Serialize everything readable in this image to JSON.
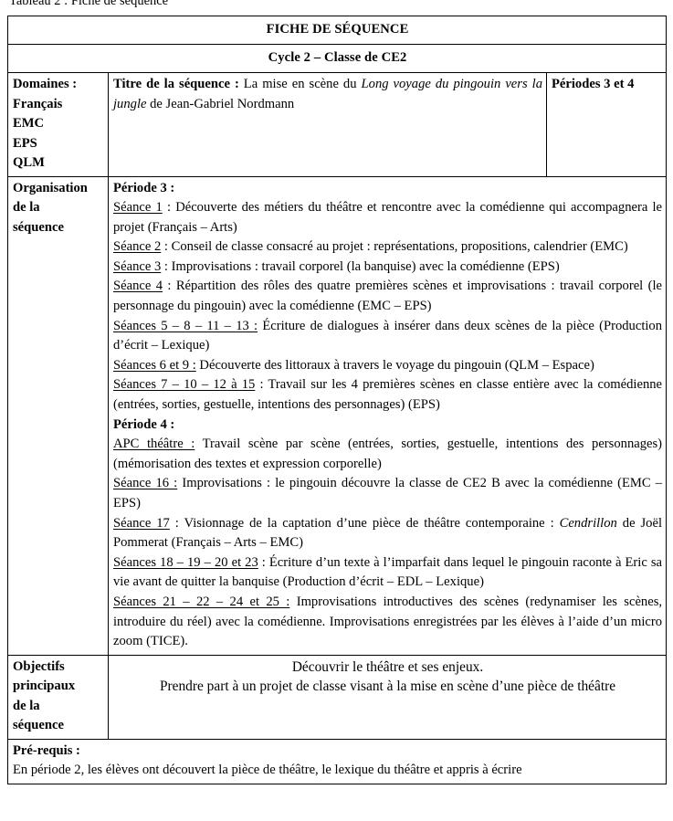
{
  "document": {
    "caption": "Tableau 2 : Fiche de séquence",
    "banner_title": "FICHE DE SÉQUENCE",
    "banner_subtitle": "Cycle 2 – Classe de CE2"
  },
  "row_domaines": {
    "label": "Domaines :\nFrançais\nEMC\nEPS\nQLM",
    "label_lines": [
      "Domaines :",
      "Français",
      "EMC",
      "EPS",
      "QLM"
    ],
    "title_prefix": "Titre de la séquence :",
    "title_text_1": " La mise en scène du ",
    "title_work": "Long voyage du pingouin vers la jungle",
    "title_text_2": " de Jean-Gabriel Nordmann",
    "periods": "Périodes 3 et 4"
  },
  "row_organisation": {
    "label_lines": [
      "Organisation",
      "de la",
      "séquence"
    ],
    "periode3_head": "Période 3 :",
    "periode4_head": "Période 4 :",
    "entries_p3": [
      {
        "marker": "Séance 1",
        "marker_includes_colon": false,
        "text": " : Découverte des métiers du théâtre et rencontre avec la comédienne qui accompagnera le projet (Français – Arts)"
      },
      {
        "marker": "Séance 2",
        "marker_includes_colon": false,
        "text": " : Conseil de classe consacré au projet : représentations, propositions, calendrier (EMC)"
      },
      {
        "marker": "Séance 3",
        "marker_includes_colon": false,
        "text": " : Improvisations : travail corporel (la banquise) avec la comédienne (EPS)"
      },
      {
        "marker": "Séance 4",
        "marker_includes_colon": false,
        "text": " : Répartition des rôles des quatre premières scènes et improvisations : travail corporel (le personnage du pingouin) avec la comédienne (EMC – EPS)"
      },
      {
        "marker": "Séances 5 – 8 – 11 – 13 :",
        "marker_includes_colon": true,
        "text": " Écriture de dialogues à insérer dans deux scènes de la pièce (Production d’écrit – Lexique)"
      },
      {
        "marker": "Séances 6 et 9 :",
        "marker_includes_colon": true,
        "text": " Découverte des littoraux à travers le voyage du pingouin (QLM – Espace)"
      },
      {
        "marker": "Séances 7 – 10 – 12 à 15",
        "marker_includes_colon": false,
        "text": " : Travail sur les 4 premières scènes en classe entière avec la comédienne (entrées, sorties, gestuelle, intentions des personnages) (EPS)"
      }
    ],
    "entries_p4": [
      {
        "marker": "APC théâtre :",
        "marker_includes_colon": true,
        "text": " Travail scène par scène (entrées, sorties, gestuelle, intentions des personnages) (mémorisation des textes et expression corporelle)"
      },
      {
        "marker": "Séance 16 :",
        "marker_includes_colon": true,
        "text": " Improvisations : le pingouin découvre la classe de CE2 B avec la comédienne (EMC – EPS)"
      },
      {
        "marker": "Séance 17",
        "marker_includes_colon": false,
        "text_before_italic": " : Visionnage de la captation d’une pièce de théâtre contemporaine : ",
        "italic": "Cendrillon",
        "text_after_italic": " de Joël Pommerat (Français – Arts – EMC)"
      },
      {
        "marker": "Séances 18 – 19 – 20 et 23",
        "marker_includes_colon": false,
        "text": " : Écriture d’un texte à l’imparfait dans lequel le pingouin raconte à Eric sa vie avant de quitter la banquise (Production d’écrit – EDL – Lexique)"
      },
      {
        "marker": "Séances 21 – 22 – 24 et 25 :",
        "marker_includes_colon": true,
        "text": " Improvisations introductives des scènes (redynamiser les scènes, introduire du réel) avec la comédienne. Improvisations enregistrées par les élèves à l’aide d’un micro zoom (TICE)."
      }
    ]
  },
  "row_objectifs": {
    "label_lines": [
      "Objectifs",
      "principaux",
      "de la",
      "séquence"
    ],
    "lines": [
      "Découvrir le théâtre et ses enjeux.",
      "Prendre part à un projet de classe visant à la mise en scène d’une pièce de théâtre"
    ]
  },
  "row_prerequis": {
    "head": "Pré-requis :",
    "text": "En période 2, les élèves ont découvert la pièce de théâtre, le lexique du théâtre et appris à écrire"
  }
}
